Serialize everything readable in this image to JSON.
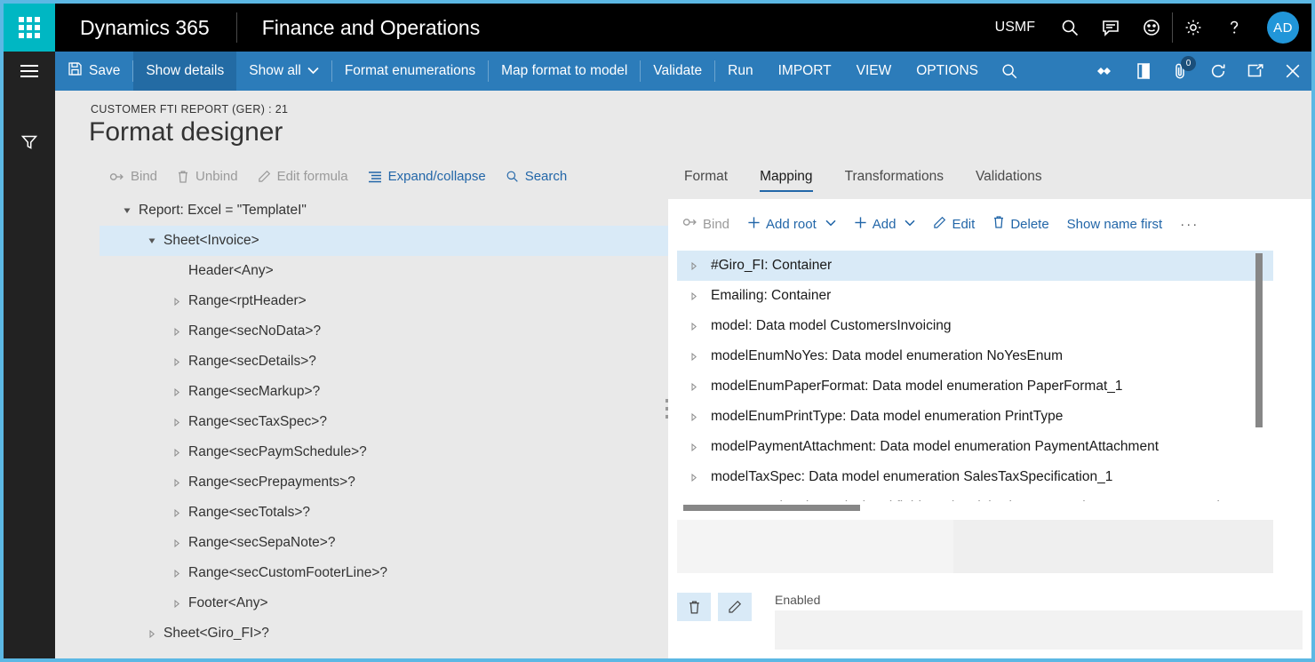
{
  "topnav": {
    "waffle_icon": "app-launcher-icon",
    "brand": "Dynamics 365",
    "module": "Finance and Operations",
    "company": "USMF",
    "icons": [
      {
        "name": "search-icon",
        "label": "Search"
      },
      {
        "name": "message-icon",
        "label": "Messages"
      },
      {
        "name": "feedback-smiley-icon",
        "label": "Feedback"
      },
      {
        "name": "gear-icon",
        "label": "Settings"
      },
      {
        "name": "help-question-icon",
        "label": "Help"
      }
    ],
    "avatar_initials": "AD"
  },
  "actionbar": {
    "hamburger_icon": "navigation-menu-icon",
    "save_label": "Save",
    "show_details_label": "Show details",
    "show_all_label": "Show all",
    "format_enumerations_label": "Format enumerations",
    "map_format_to_model_label": "Map format to model",
    "validate_label": "Validate",
    "run_label": "Run",
    "import_label": "IMPORT",
    "view_label": "VIEW",
    "options_label": "OPTIONS",
    "search_icon": "search-icon",
    "right_icons": [
      {
        "name": "related-information-icon"
      },
      {
        "name": "office-icon"
      },
      {
        "name": "attachments-icon",
        "badge": "0"
      },
      {
        "name": "refresh-icon"
      },
      {
        "name": "open-in-new-window-icon"
      },
      {
        "name": "close-icon"
      }
    ]
  },
  "leftrail": {
    "filter_icon": "filter-funnel-icon"
  },
  "page": {
    "caption": "CUSTOMER FTI REPORT (GER) : 21",
    "title": "Format designer"
  },
  "tree_toolbar": [
    {
      "label": "Bind",
      "icon": "bind-link-icon",
      "disabled": true
    },
    {
      "label": "Unbind",
      "icon": "unbind-trash-icon",
      "disabled": true
    },
    {
      "label": "Edit formula",
      "icon": "edit-pencil-icon",
      "disabled": true
    },
    {
      "label": "Expand/collapse",
      "icon": "expand-collapse-list-icon",
      "disabled": false
    },
    {
      "label": "Search",
      "icon": "search-icon",
      "disabled": false
    }
  ],
  "tree": [
    {
      "label": "Report: Excel = \"TemplateI\"",
      "indent": 0,
      "state": "expanded",
      "selected": false
    },
    {
      "label": "Sheet<Invoice>",
      "indent": 1,
      "state": "expanded",
      "selected": true
    },
    {
      "label": "Header<Any>",
      "indent": 2,
      "state": "leaf",
      "selected": false
    },
    {
      "label": "Range<rptHeader>",
      "indent": 2,
      "state": "collapsed",
      "selected": false
    },
    {
      "label": "Range<secNoData>?",
      "indent": 2,
      "state": "collapsed",
      "selected": false
    },
    {
      "label": "Range<secDetails>?",
      "indent": 2,
      "state": "collapsed",
      "selected": false
    },
    {
      "label": "Range<secMarkup>?",
      "indent": 2,
      "state": "collapsed",
      "selected": false
    },
    {
      "label": "Range<secTaxSpec>?",
      "indent": 2,
      "state": "collapsed",
      "selected": false
    },
    {
      "label": "Range<secPaymSchedule>?",
      "indent": 2,
      "state": "collapsed",
      "selected": false
    },
    {
      "label": "Range<secPrepayments>?",
      "indent": 2,
      "state": "collapsed",
      "selected": false
    },
    {
      "label": "Range<secTotals>?",
      "indent": 2,
      "state": "collapsed",
      "selected": false
    },
    {
      "label": "Range<secSepaNote>?",
      "indent": 2,
      "state": "collapsed",
      "selected": false
    },
    {
      "label": "Range<secCustomFooterLine>?",
      "indent": 2,
      "state": "collapsed",
      "selected": false
    },
    {
      "label": "Footer<Any>",
      "indent": 2,
      "state": "collapsed",
      "selected": false
    },
    {
      "label": "Sheet<Giro_FI>?",
      "indent": 1,
      "state": "collapsed",
      "selected": false
    }
  ],
  "right_tabs": [
    {
      "label": "Format",
      "active": false
    },
    {
      "label": "Mapping",
      "active": true
    },
    {
      "label": "Transformations",
      "active": false
    },
    {
      "label": "Validations",
      "active": false
    }
  ],
  "mapping_toolbar": [
    {
      "label": "Bind",
      "icon": "bind-link-icon",
      "disabled": true,
      "caret": false,
      "plus": false
    },
    {
      "label": "Add root",
      "icon": "plus-icon",
      "disabled": false,
      "caret": true,
      "plus": true
    },
    {
      "label": "Add",
      "icon": "plus-icon",
      "disabled": false,
      "caret": true,
      "plus": true
    },
    {
      "label": "Edit",
      "icon": "edit-pencil-icon",
      "disabled": false,
      "caret": false,
      "plus": false
    },
    {
      "label": "Delete",
      "icon": "delete-trash-icon",
      "disabled": false,
      "caret": false,
      "plus": false
    },
    {
      "label": "Show name first",
      "icon": "",
      "disabled": false,
      "caret": false,
      "plus": false
    },
    {
      "label": "···",
      "icon": "overflow-ellipsis-icon",
      "disabled": false,
      "caret": false,
      "plus": false
    }
  ],
  "mapping_rows": [
    {
      "label": "#Giro_FI: Container",
      "selected": true
    },
    {
      "label": "Emailing: Container",
      "selected": false
    },
    {
      "label": "model: Data model CustomersInvoicing",
      "selected": false
    },
    {
      "label": "modelEnumNoYes: Data model enumeration NoYesEnum",
      "selected": false
    },
    {
      "label": "modelEnumPaperFormat: Data model enumeration PaperFormat_1",
      "selected": false
    },
    {
      "label": "modelEnumPrintType: Data model enumeration PrintType",
      "selected": false
    },
    {
      "label": "modelPaymentAttachment: Data model enumeration PaymentAttachment",
      "selected": false
    },
    {
      "label": "modelTaxSpec: Data model enumeration SalesTaxSpecification_1",
      "selected": false
    },
    {
      "label": "RptFooterLineList: Calculated field = IF(model.PrintMgmtSetting.PaperFormat=mode",
      "selected": false
    }
  ],
  "footer": {
    "delete_icon": "delete-trash-icon",
    "edit_icon": "edit-pencil-icon",
    "enabled_label": "Enabled",
    "enabled_value": ""
  },
  "colors": {
    "page_border": "#5cb8e4",
    "topnav_bg": "#000000",
    "waffle_bg": "#00b7c3",
    "actionbar_bg": "#2c7cba",
    "actionbar_active": "#236ba4",
    "rail_bg": "#222222",
    "page_bg": "#e9e9e9",
    "card_bg": "#ffffff",
    "selection_bg": "#d9eaf7",
    "link_blue": "#2266a8",
    "disabled_gray": "#9a9a9a",
    "scrollbar": "#878787",
    "avatar_bg": "#2196d9"
  }
}
